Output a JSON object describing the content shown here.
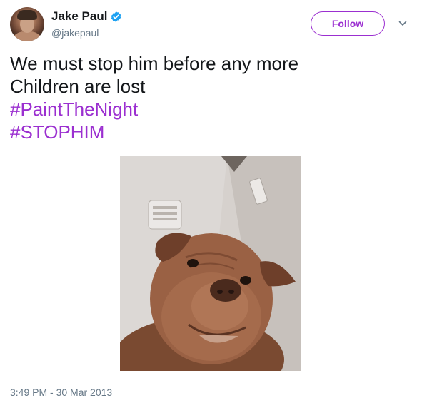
{
  "user": {
    "display_name": "Jake Paul",
    "handle": "@jakepaul",
    "verified": true
  },
  "actions": {
    "follow_label": "Follow"
  },
  "tweet": {
    "text_line1": "We must stop him before any more",
    "text_line2": "Children are lost",
    "hashtags": [
      "#PaintTheNight",
      "#STOPHIM"
    ]
  },
  "meta": {
    "timestamp": "3:49 PM - 30 Mar 2013"
  },
  "colors": {
    "accent": "#9b2fd0",
    "verified": "#1da1f2",
    "text": "#14171a",
    "muted": "#657786"
  },
  "icons": {
    "verified": "verified-badge-icon",
    "menu": "chevron-down-icon"
  }
}
